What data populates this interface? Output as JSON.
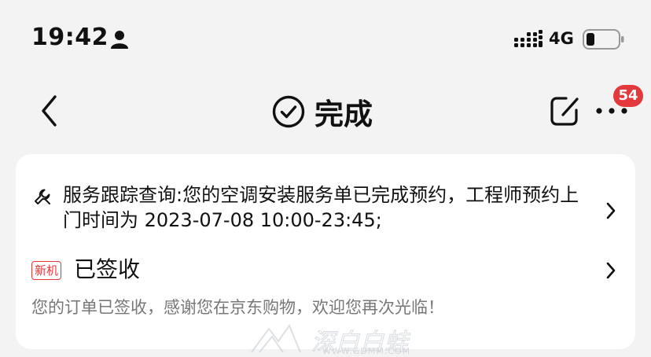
{
  "status_bar": {
    "time": "19:42",
    "network": "4G",
    "icons": [
      "person-icon",
      "signal-icon",
      "battery-icon"
    ]
  },
  "nav": {
    "back_icon": "chevron-left-icon",
    "title_icon": "check-circle-icon",
    "title": "完成",
    "share_icon": "share-icon",
    "more_icon": "more-icon",
    "badge_count": "54"
  },
  "card": {
    "tracking": {
      "icon": "wrench-icon",
      "text": "服务跟踪查询:您的空调安装服务单已完成预约，工程师预约上门时间为 2023-07-08 10:00-23:45;"
    },
    "signed": {
      "tag": "新机",
      "title": "已签收",
      "description": "您的订单已签收，感谢您在京东购物，欢迎您再次光临！"
    }
  },
  "watermark": {
    "text": "深白白蛙",
    "url": "WWW.GDMM.COM"
  },
  "colors": {
    "accent": "#e4393c",
    "background": "#f3f3f3",
    "card": "#ffffff",
    "muted_text": "#777777"
  }
}
